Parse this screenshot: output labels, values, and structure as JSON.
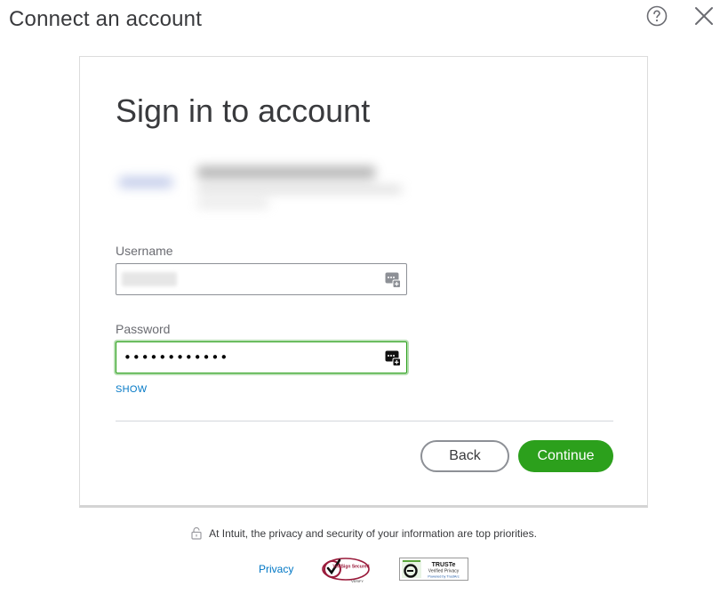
{
  "header": {
    "title": "Connect an account",
    "help_icon": "question-circle-icon",
    "close_icon": "close-x-icon"
  },
  "card": {
    "title": "Sign in to account",
    "username": {
      "label": "Username",
      "value": ""
    },
    "password": {
      "label": "Password",
      "value": "••••••••••••"
    },
    "show_label": "SHOW",
    "back_label": "Back",
    "continue_label": "Continue"
  },
  "footer": {
    "note": "At Intuit, the privacy and security of your information are top priorities.",
    "privacy_label": "Privacy",
    "verisign_text": "VeriSign Secured",
    "verisign_verify": "VERIFY",
    "truste_title": "TRUSTe",
    "truste_sub": "Verified Privacy",
    "truste_powered": "Powered by TrustArc"
  },
  "colors": {
    "accent": "#2ca01c",
    "link": "#0077c5",
    "text": "#393a3d"
  }
}
